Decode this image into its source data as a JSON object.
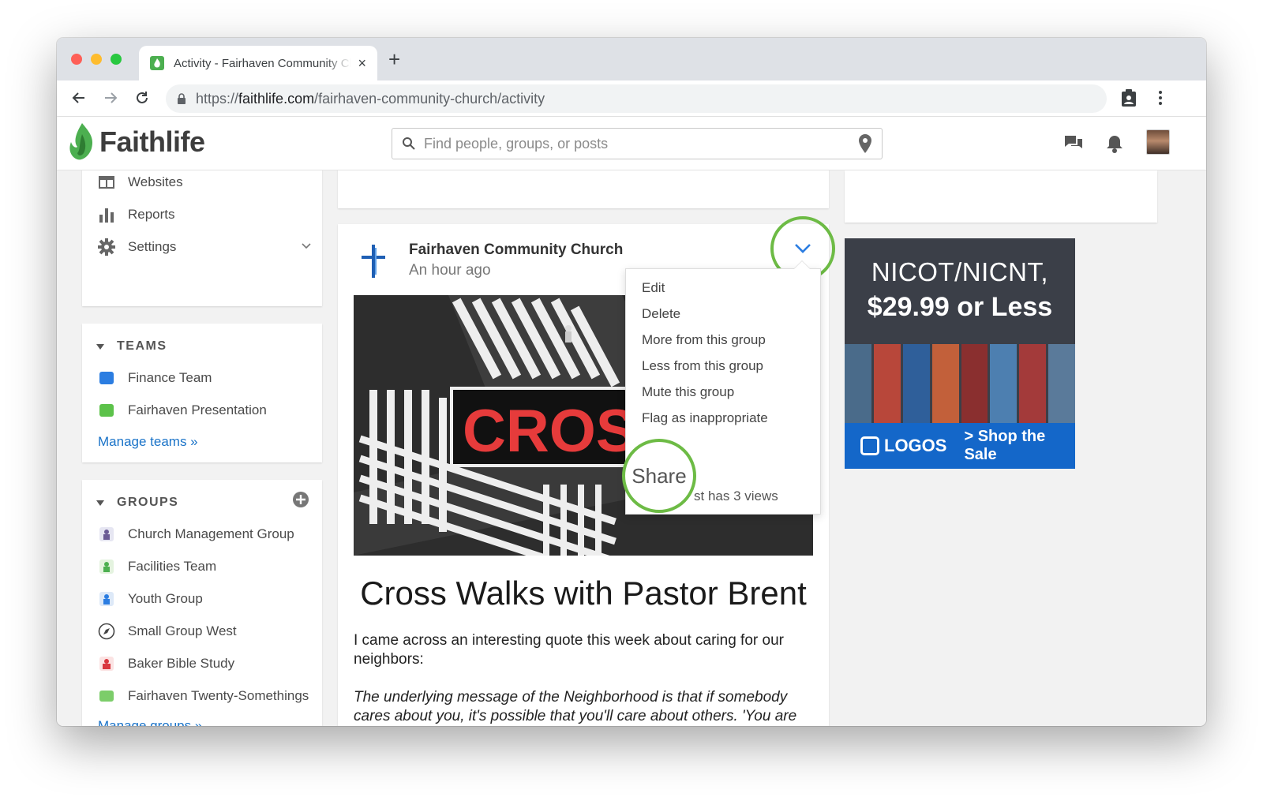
{
  "browser": {
    "tab_title": "Activity - Fairhaven Community Church",
    "tab_close": "×",
    "new_tab": "+",
    "url_scheme": "https://",
    "url_host": "faithlife.com",
    "url_path": "/fairhaven-community-church/activity"
  },
  "header": {
    "logo_text": "Faithlife",
    "search_placeholder": "Find people, groups, or posts"
  },
  "sidebar": {
    "admin_items": [
      {
        "label": "Websites"
      },
      {
        "label": "Reports"
      },
      {
        "label": "Settings"
      }
    ],
    "teams": {
      "title": "TEAMS",
      "items": [
        {
          "label": "Finance Team",
          "color": "#2b7de1"
        },
        {
          "label": "Fairhaven Presentation",
          "color": "#5cc24a"
        }
      ],
      "manage_link": "Manage teams »"
    },
    "groups": {
      "title": "GROUPS",
      "items": [
        {
          "label": "Church Management Group"
        },
        {
          "label": "Facilities Team"
        },
        {
          "label": "Youth Group"
        },
        {
          "label": "Small Group West"
        },
        {
          "label": "Baker Bible Study"
        },
        {
          "label": "Fairhaven Twenty-Somethings"
        }
      ],
      "manage_link": "Manage groups »"
    }
  },
  "post": {
    "author": "Fairhaven Community Church",
    "time": "An hour ago",
    "image_text": "CROSS WA",
    "title": "Cross Walks with Pastor Brent",
    "body": "I came across an interesting quote this week about caring for our neighbors:",
    "quote": "The underlying message of the Neighborhood is that if somebody cares about you, it's possible that you'll care about others. 'You are special, and so is your neighbor' - that part is essential: that you're not"
  },
  "post_menu": {
    "items": [
      "Edit",
      "Delete",
      "More from this group",
      "Less from this group",
      "Mute this group",
      "Flag as inappropriate"
    ],
    "share": "Share",
    "views": "st has 3 views"
  },
  "ad": {
    "line1": "NICOT/NICNT,",
    "line2": "$29.99 or Less",
    "brand": "LOGOS",
    "cta": "> Shop the Sale"
  },
  "colors": {
    "accent_green": "#6dbb45",
    "link_blue": "#1a73c8",
    "ad_blue": "#1467c9"
  }
}
